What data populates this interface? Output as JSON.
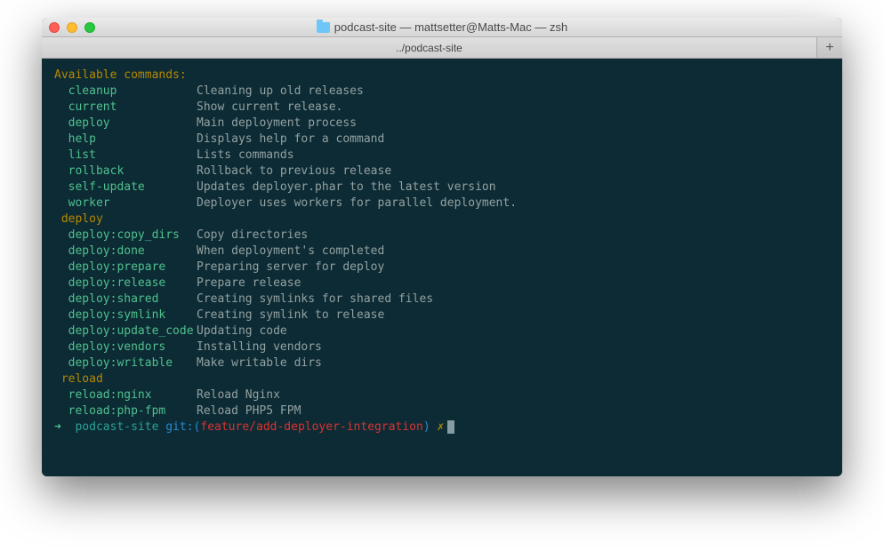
{
  "window": {
    "title": "podcast-site — mattsetter@Matts-Mac — zsh",
    "folder_icon": "folder-icon"
  },
  "tabs": [
    {
      "label": "../podcast-site"
    }
  ],
  "newtab_label": "+",
  "sections": [
    {
      "header": "Available commands:",
      "items": [
        {
          "name": "cleanup",
          "desc": "Cleaning up old releases"
        },
        {
          "name": "current",
          "desc": "Show current release."
        },
        {
          "name": "deploy",
          "desc": "Main deployment process"
        },
        {
          "name": "help",
          "desc": "Displays help for a command"
        },
        {
          "name": "list",
          "desc": "Lists commands"
        },
        {
          "name": "rollback",
          "desc": "Rollback to previous release"
        },
        {
          "name": "self-update",
          "desc": "Updates deployer.phar to the latest version"
        },
        {
          "name": "worker",
          "desc": "Deployer uses workers for parallel deployment."
        }
      ]
    },
    {
      "header": "deploy",
      "items": [
        {
          "name": "deploy:copy_dirs",
          "desc": "Copy directories"
        },
        {
          "name": "deploy:done",
          "desc": "When deployment's completed"
        },
        {
          "name": "deploy:prepare",
          "desc": "Preparing server for deploy"
        },
        {
          "name": "deploy:release",
          "desc": "Prepare release"
        },
        {
          "name": "deploy:shared",
          "desc": "Creating symlinks for shared files"
        },
        {
          "name": "deploy:symlink",
          "desc": "Creating symlink to release"
        },
        {
          "name": "deploy:update_code",
          "desc": "Updating code"
        },
        {
          "name": "deploy:vendors",
          "desc": "Installing vendors"
        },
        {
          "name": "deploy:writable",
          "desc": "Make writable dirs"
        }
      ]
    },
    {
      "header": "reload",
      "items": [
        {
          "name": "reload:nginx",
          "desc": "Reload Nginx"
        },
        {
          "name": "reload:php-fpm",
          "desc": "Reload PHP5 FPM"
        }
      ]
    }
  ],
  "prompt": {
    "arrow": "➜",
    "dir": "podcast-site",
    "git_label_open": "git:(",
    "branch": "feature/add-deployer-integration",
    "git_label_close": ")",
    "dirty": "✗"
  },
  "colors": {
    "bg": "#0d2b35",
    "section": "#b58900",
    "name": "#4fc08d",
    "desc": "#93a1a1",
    "branch": "#dc322f",
    "git": "#268bd2",
    "dir": "#2aa198"
  }
}
